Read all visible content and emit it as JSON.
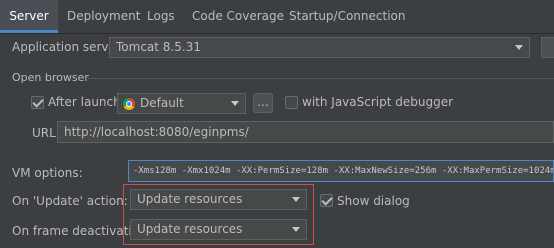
{
  "tabs": [
    {
      "label": "Server",
      "active": true
    },
    {
      "label": "Deployment",
      "active": false
    },
    {
      "label": "Logs",
      "active": false
    },
    {
      "label": "Code Coverage",
      "active": false
    },
    {
      "label": "Startup/Connection",
      "active": false
    }
  ],
  "app_server": {
    "label": "Application server:",
    "value": "Tomcat 8.5.31"
  },
  "open_browser": {
    "section_label": "Open browser",
    "after_launch_label": "After launch",
    "after_launch_checked": true,
    "browser_value": "Default",
    "dots_label": "...",
    "js_debugger_label": "with JavaScript debugger",
    "js_debugger_checked": false,
    "url_label": "URL:",
    "url_value": "http://localhost:8080/eginpms/"
  },
  "vm": {
    "label": "VM options:",
    "value": "-Xms128m -Xmx1024m -XX:PermSize=128m -XX:MaxNewSize=256m -XX:MaxPermSize=1024m"
  },
  "update_action": {
    "label": "On 'Update' action:",
    "value": "Update resources"
  },
  "show_dialog": {
    "label": "Show dialog",
    "checked": true
  },
  "frame_deactivation": {
    "label": "On frame deactivation:",
    "value": "Update resources"
  },
  "colors": {
    "background": "#3c3f41",
    "accent": "#4a88c7",
    "highlight_border": "#d34b47"
  }
}
